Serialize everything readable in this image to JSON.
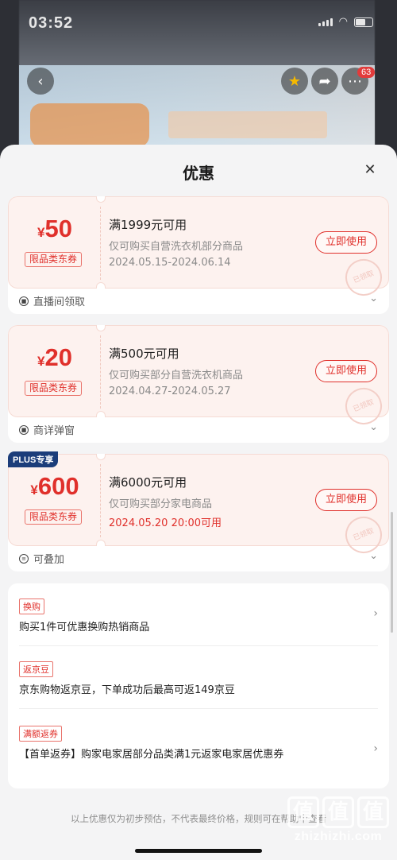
{
  "status_bar": {
    "time": "03:52"
  },
  "background": {
    "notification_count": "63"
  },
  "sheet": {
    "title": "优惠",
    "close_icon": "close-icon"
  },
  "coupons": [
    {
      "currency": "¥",
      "amount": "50",
      "tag": "限品类东券",
      "condition": "满1999元可用",
      "scope": "仅可购买自营洗衣机部分商品",
      "validity": "2024.05.15-2024.06.14",
      "button": "立即使用",
      "source": "直播间领取",
      "stamp": "已领取"
    },
    {
      "currency": "¥",
      "amount": "20",
      "tag": "限品类东券",
      "condition": "满500元可用",
      "scope": "仅可购买部分自营洗衣机商品",
      "validity": "2024.04.27-2024.05.27",
      "button": "立即使用",
      "source": "商详弹窗",
      "stamp": "已领取"
    },
    {
      "badge": "PLUS专享",
      "currency": "¥",
      "amount": "600",
      "tag": "限品类东券",
      "condition": "满6000元可用",
      "scope": "仅可购买部分家电商品",
      "validity": "2024.05.20 20:00可用",
      "button": "立即使用",
      "source": "可叠加",
      "stamp": "已领取"
    }
  ],
  "benefits": [
    {
      "tag": "换购",
      "text": "购买1件可优惠换购热销商品"
    },
    {
      "tag": "返京豆",
      "text": "京东购物返京豆，下单成功后最高可返149京豆"
    },
    {
      "tag": "满额返券",
      "text": "【首单返券】购家电家居部分品类满1元返家电家居优惠券"
    }
  ],
  "footer": {
    "text": "以上优惠仅为初步预估，不代表最终价格，规则可在帮助中查看"
  },
  "watermark": {
    "logo": "值值值",
    "site": "zhizhizhi.com"
  },
  "colors": {
    "accent": "#e0302b",
    "coupon_bg": "#fdf2ef",
    "plus_badge": "#1b3d7a"
  }
}
